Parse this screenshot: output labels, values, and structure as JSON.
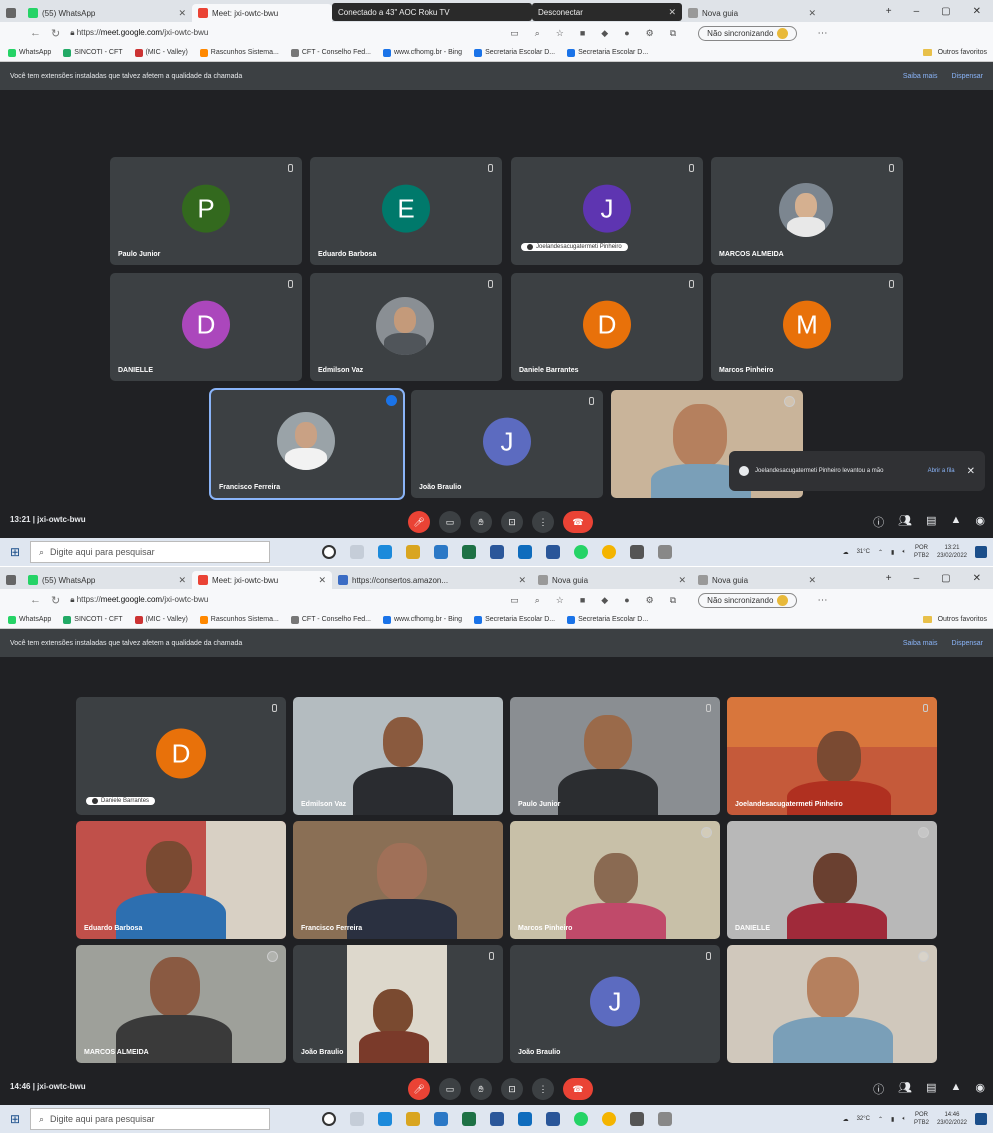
{
  "browser": {
    "tabs": [
      {
        "label": "(55) WhatsApp",
        "fav": "#25d366"
      },
      {
        "label": "Meet: jxi-owtc-bwu",
        "fav": "#ea4335"
      },
      {
        "label": "Conectado a 43\" AOC Roku TV",
        "fav": "#444"
      },
      {
        "label": "Desconectar",
        "fav": "#555"
      },
      {
        "label": "Nova guia",
        "fav": "#999"
      }
    ],
    "tabs_shot2": [
      {
        "label": "(55) WhatsApp",
        "fav": "#25d366"
      },
      {
        "label": "Meet: jxi-owtc-bwu",
        "fav": "#ea4335"
      },
      {
        "label": "https://consertos.amazon...",
        "fav": "#3b6cc4"
      },
      {
        "label": "Nova guia",
        "fav": "#999"
      },
      {
        "label": "Nova guia",
        "fav": "#999"
      }
    ],
    "url_host": "meet.google.com",
    "url_path": "/jxi-owtc-bwu",
    "url_prefix": "https://",
    "sync_label": "Não sincronizando",
    "bookmarks": [
      {
        "label": "WhatsApp",
        "fav": "#25d366"
      },
      {
        "label": "SINCOTI - CFT",
        "fav": "#2a6"
      },
      {
        "label": "(MIC - Valley)",
        "fav": "#c33"
      },
      {
        "label": "Rascunhos Sistema...",
        "fav": "#f80"
      },
      {
        "label": "CFT - Conselho Fed...",
        "fav": "#777"
      },
      {
        "label": "www.cfhomg.br - Bing",
        "fav": "#1a73e8"
      },
      {
        "label": "Secretaria Escolar D...",
        "fav": "#1a73e8"
      },
      {
        "label": "Secretaria Escolar D...",
        "fav": "#1a73e8"
      }
    ],
    "favorites_label": "Outros favoritos"
  },
  "notice": {
    "text": "Você tem extensões instaladas que talvez afetem a qualidade da chamada",
    "action1": "Saiba mais",
    "action2": "Dispensar"
  },
  "shot1": {
    "time": "13:21",
    "meeting_code": "jxi-owtc-bwu",
    "participants": [
      {
        "name": "Paulo Junior",
        "initial": "P",
        "color": "#33691e"
      },
      {
        "name": "Eduardo Barbosa",
        "initial": "E",
        "color": "#00796b"
      },
      {
        "name": "",
        "initial": "J",
        "color": "#5e35b1",
        "pin": "Joelandesacugatermeti Pinheiro"
      },
      {
        "name": "MARCOS ALMEIDA",
        "initial": "",
        "color": "#7c8690"
      },
      {
        "name": "DANIELLE",
        "initial": "D",
        "color": "#ab47bc"
      },
      {
        "name": "Edmilson Vaz",
        "initial": "",
        "color": "#8a8f94"
      },
      {
        "name": "Daniele Barrantes",
        "initial": "D",
        "color": "#e8710a"
      },
      {
        "name": "Marcos Pinheiro",
        "initial": "M",
        "color": "#e8710a"
      },
      {
        "name": "Francisco Ferreira",
        "initial": "",
        "color": "#9aa3a8"
      },
      {
        "name": "João Braulio",
        "initial": "J",
        "color": "#5c6bc0"
      },
      {
        "name": "",
        "initial": "",
        "color": "#c9b49a"
      }
    ],
    "toast": {
      "text": "Joelandesacugatermeti Pinheiro levantou a mão",
      "link": "Abrir a fila"
    }
  },
  "shot2": {
    "time": "14:46",
    "meeting_code": "jxi-owtc-bwu",
    "participants": [
      {
        "name": "",
        "initial": "D",
        "color": "#e8710a",
        "pin": "Daniele Barrantes"
      },
      {
        "name": "Edmilson Vaz",
        "initial": "",
        "color": "#b4bcc0"
      },
      {
        "name": "Paulo Junior",
        "initial": "",
        "color": "#8a8e92"
      },
      {
        "name": "Joelandesacugatermeti Pinheiro",
        "initial": "",
        "color": "#c55a3a"
      },
      {
        "name": "Eduardo Barbosa",
        "initial": "",
        "color": "#c0504a"
      },
      {
        "name": "Francisco Ferreira",
        "initial": "",
        "color": "#8a6f55"
      },
      {
        "name": "Marcos Pinheiro",
        "initial": "",
        "color": "#c8c0a8"
      },
      {
        "name": "DANIELLE",
        "initial": "",
        "color": "#b8b8b8"
      },
      {
        "name": "MARCOS ALMEIDA",
        "initial": "",
        "color": "#9ea09a"
      },
      {
        "name": "João Braulio",
        "initial": "",
        "color": "#3c4043"
      },
      {
        "name": "João Braulio",
        "initial": "J",
        "color": "#5c6bc0"
      },
      {
        "name": "",
        "initial": "",
        "color": "#d0c8bc"
      }
    ]
  },
  "taskbar": {
    "search_placeholder": "Digite aqui para pesquisar",
    "temp1": "31°C",
    "temp2": "32°C",
    "lang": "POR",
    "lang2": "PTB2",
    "clock1": "13:21",
    "clock2": "14:46",
    "date": "23/02/2022"
  }
}
